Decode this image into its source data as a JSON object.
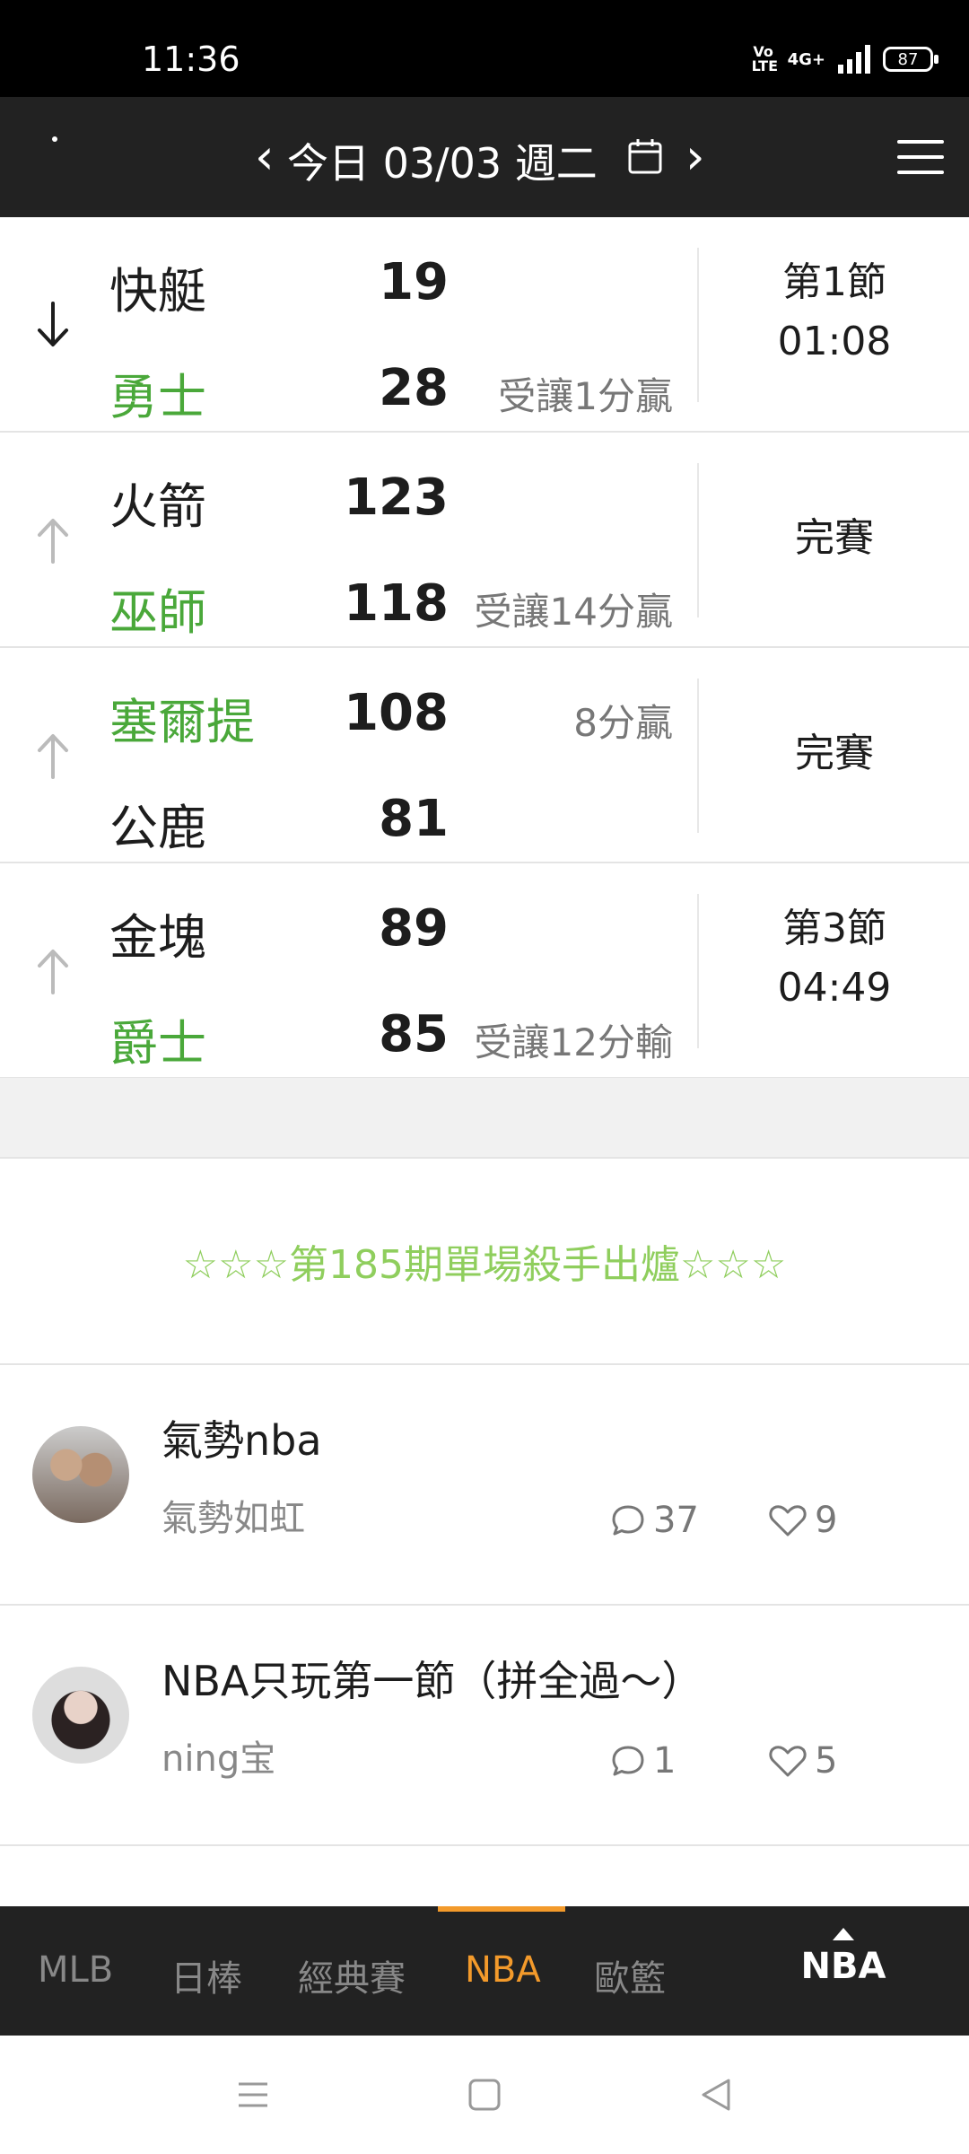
{
  "status_bar": {
    "time": "11:36",
    "volte": "Vo LTE",
    "network": "4G+",
    "battery": "87"
  },
  "header": {
    "date_label": "今日 03/03 週二"
  },
  "games": [
    {
      "team1": "快艇",
      "score1": "19",
      "note1": "",
      "team2": "勇士",
      "score2": "28",
      "note2": "受讓1分贏",
      "winner": 2,
      "arrow": "down",
      "status_line1": "第1節",
      "status_line2": "01:08"
    },
    {
      "team1": "火箭",
      "score1": "123",
      "note1": "",
      "team2": "巫師",
      "score2": "118",
      "note2": "受讓14分贏",
      "winner": 2,
      "arrow": "up",
      "status_line1": "完賽",
      "status_line2": ""
    },
    {
      "team1": "塞爾提",
      "score1": "108",
      "note1": "8分贏",
      "team2": "公鹿",
      "score2": "81",
      "note2": "",
      "winner": 1,
      "arrow": "up",
      "status_line1": "完賽",
      "status_line2": ""
    },
    {
      "team1": "金塊",
      "score1": "89",
      "note1": "",
      "team2": "爵士",
      "score2": "85",
      "note2": "受讓12分輸",
      "winner": 2,
      "arrow": "up",
      "status_line1": "第3節",
      "status_line2": "04:49"
    }
  ],
  "banner": {
    "text": "☆☆☆第185期單場殺手出爐☆☆☆"
  },
  "posts": [
    {
      "title": "氣勢nba",
      "author": "氣勢如虹",
      "comments": "37",
      "likes": "9"
    },
    {
      "title": "NBA只玩第一節（拼全過～）",
      "author": "ning宝",
      "comments": "1",
      "likes": "5"
    }
  ],
  "bottom_nav": {
    "tabs": [
      "MLB",
      "日棒",
      "經典賽",
      "NBA",
      "歐籃"
    ],
    "active": "NBA",
    "current_league": "NBA"
  },
  "colors": {
    "win_green": "#4aa83a",
    "accent_orange": "#f39a2b",
    "banner_green": "#8fce5d",
    "bar_dark": "#222222"
  }
}
